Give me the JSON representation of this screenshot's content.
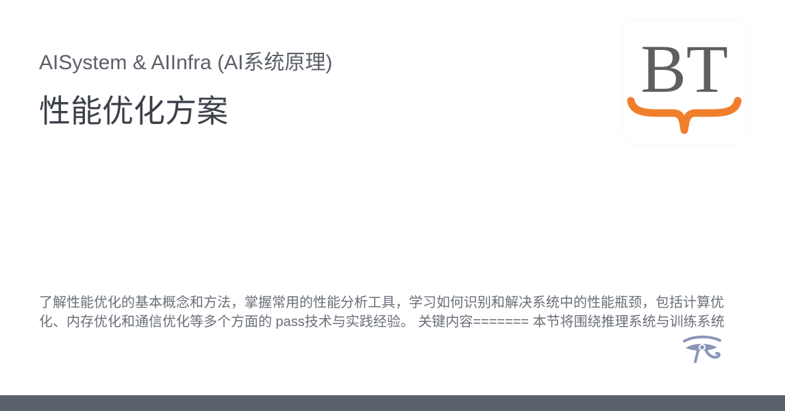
{
  "card": {
    "subtitle": "AISystem & AIInfra (AI系统原理)",
    "title": "性能优化方案",
    "description": "了解性能优化的基本概念和方法，掌握常用的性能分析工具，学习如何识别和解决系统中的性能瓶颈，包括计算优化、内存优化和通信优化等多个方面的 pass技术与实践经验。 关键内容======= 本节将围绕推理系统与训练系统的性能展开 核心要点: 优化与调度: 从算子级到系统级的全栈式优化方法与工程实践经验总结与分析…",
    "logo_text": "BT"
  },
  "colors": {
    "logo_gray": "#5f5f5f",
    "logo_orange": "#f07f2c",
    "eye_blue": "#8a95b8",
    "footer": "#5b616d"
  },
  "icons": {
    "logo": "bt-logo",
    "eye": "eye-of-horus-icon"
  }
}
